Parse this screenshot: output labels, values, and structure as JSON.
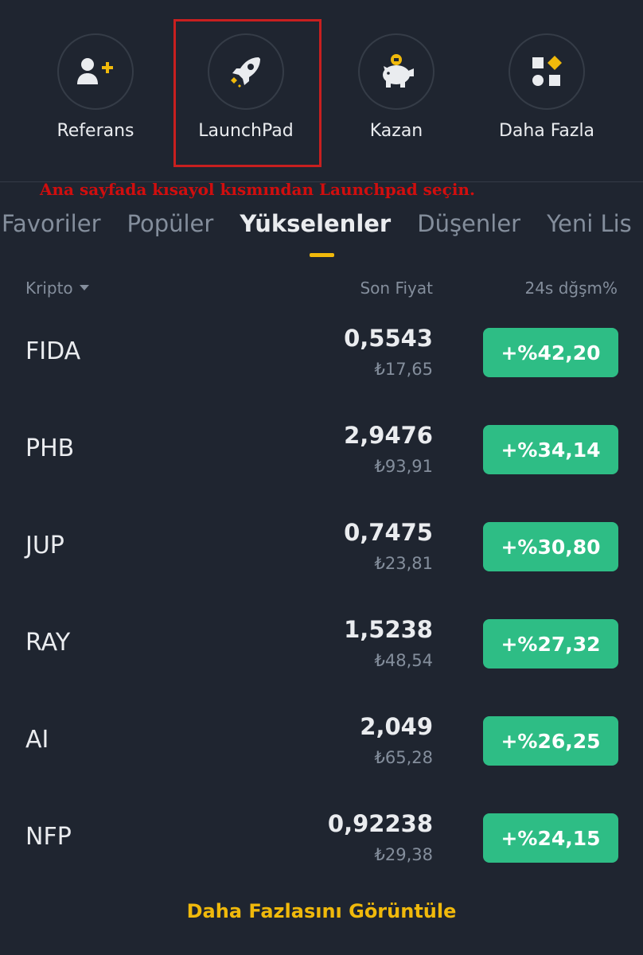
{
  "shortcuts": [
    {
      "label": "Referans",
      "icon": "add-user-icon"
    },
    {
      "label": "LaunchPad",
      "icon": "rocket-icon"
    },
    {
      "label": "Kazan",
      "icon": "piggy-bank-icon"
    },
    {
      "label": "Daha Fazla",
      "icon": "more-apps-icon"
    }
  ],
  "annotation": "Ana sayfada kısayol kısmından Launchpad seçin.",
  "tabs": [
    "Favoriler",
    "Popüler",
    "Yükselenler",
    "Düşenler",
    "Yeni Lis"
  ],
  "active_tab": "Yükselenler",
  "columns": {
    "crypto": "Kripto",
    "price": "Son Fiyat",
    "change": "24s dğşm%"
  },
  "rows": [
    {
      "symbol": "FIDA",
      "price": "0,5543",
      "fiat": "₺17,65",
      "change": "+%42,20"
    },
    {
      "symbol": "PHB",
      "price": "2,9476",
      "fiat": "₺93,91",
      "change": "+%34,14"
    },
    {
      "symbol": "JUP",
      "price": "0,7475",
      "fiat": "₺23,81",
      "change": "+%30,80"
    },
    {
      "symbol": "RAY",
      "price": "1,5238",
      "fiat": "₺48,54",
      "change": "+%27,32"
    },
    {
      "symbol": "AI",
      "price": "2,049",
      "fiat": "₺65,28",
      "change": "+%26,25"
    },
    {
      "symbol": "NFP",
      "price": "0,92238",
      "fiat": "₺29,38",
      "change": "+%24,15"
    }
  ],
  "view_more": "Daha Fazlasını Görüntüle",
  "colors": {
    "background": "#1f2530",
    "accent": "#f0b90b",
    "positive": "#2ebd85",
    "annotation": "#d10e0e",
    "highlight_box": "#c81f1f"
  }
}
